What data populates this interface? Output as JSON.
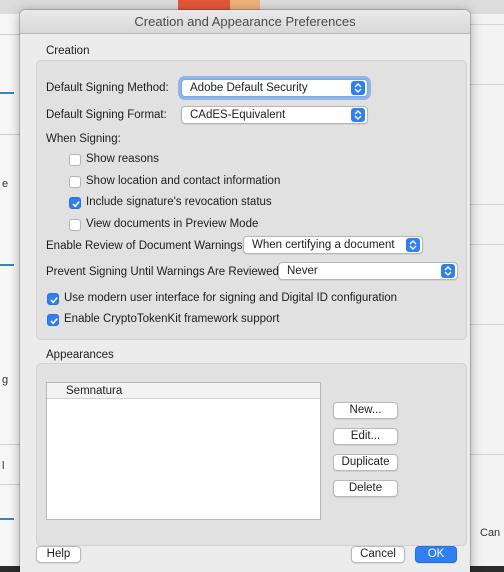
{
  "dialog": {
    "title": "Creation and Appearance Preferences",
    "creation_label": "Creation",
    "appearances_label": "Appearances"
  },
  "creation": {
    "signing_method_label": "Default Signing Method:",
    "signing_method_value": "Adobe Default Security",
    "signing_format_label": "Default Signing Format:",
    "signing_format_value": "CAdES-Equivalent",
    "when_signing_label": "When Signing:",
    "options": [
      {
        "label": "Show reasons",
        "checked": false
      },
      {
        "label": "Show location and contact information",
        "checked": false
      },
      {
        "label": "Include signature's revocation status",
        "checked": true
      },
      {
        "label": "View documents in Preview Mode",
        "checked": false
      }
    ],
    "review_warnings_label": "Enable Review of Document Warnings:",
    "review_warnings_value": "When certifying a document",
    "prevent_signing_label": "Prevent Signing Until Warnings Are Reviewed:",
    "prevent_signing_value": "Never",
    "modern_ui_label": "Use modern user interface for signing and Digital ID configuration",
    "modern_ui_checked": true,
    "cryptotokenkit_label": "Enable CryptoTokenKit framework support",
    "cryptotokenkit_checked": true
  },
  "appearances": {
    "list_items": [
      "Semnatura"
    ],
    "buttons": {
      "new": "New...",
      "edit": "Edit...",
      "duplicate": "Duplicate",
      "delete": "Delete"
    }
  },
  "footer": {
    "help": "Help",
    "cancel": "Cancel",
    "ok": "OK"
  },
  "background": {
    "left_fragments": [
      "e",
      "g",
      "l"
    ],
    "right_fragment": "Can"
  },
  "colors": {
    "accent": "#2f80ed"
  }
}
